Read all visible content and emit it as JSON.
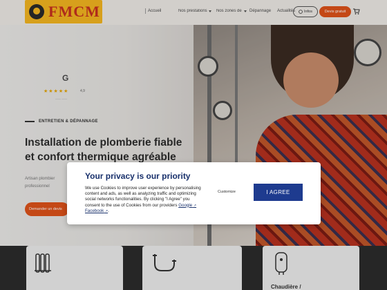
{
  "logo": {
    "text": "FMCM"
  },
  "nav": {
    "items": [
      {
        "label": "Accueil",
        "dropdown": false
      },
      {
        "label": "Nos prestations",
        "dropdown": true
      },
      {
        "label": "Nos zones de travail",
        "dropdown": true
      },
      {
        "label": "Dépannage",
        "dropdown": false
      },
      {
        "label": "Actualités",
        "dropdown": false
      }
    ],
    "outline_button": "Infos",
    "solid_button": "Devis gratuit"
  },
  "hero": {
    "google": {
      "letter": "G",
      "stars": "★★★★★",
      "score": "4,9",
      "count": "—— ——"
    },
    "kicker": "ENTRETIEN & DÉPANNAGE",
    "title_line1": "Installation de plomberie fiable",
    "title_line2": "et confort thermique agréable",
    "subtitle_line1": "Artisan plombier",
    "subtitle_line2": "professionnel",
    "cta": "Demander un devis"
  },
  "cards": [
    {
      "title": ""
    },
    {
      "title": ""
    },
    {
      "title": "Chaudière /"
    }
  ],
  "privacy": {
    "title": "Your privacy is our priority",
    "body": "We use Cookies to improve user experience by personalising content and ads, as well as analyzing traffic and optimizing social networks functionalities. By clicking \"I Agree\" you consent to the use of Cookies from our providers",
    "link_google": "Google",
    "link_facebook": "Facebook",
    "customize_label": "Customize",
    "agree_label": "I AGREE"
  },
  "colors": {
    "accent_orange": "#e0521a",
    "logo_yellow": "#f5b720",
    "privacy_blue": "#1e3b8f"
  }
}
